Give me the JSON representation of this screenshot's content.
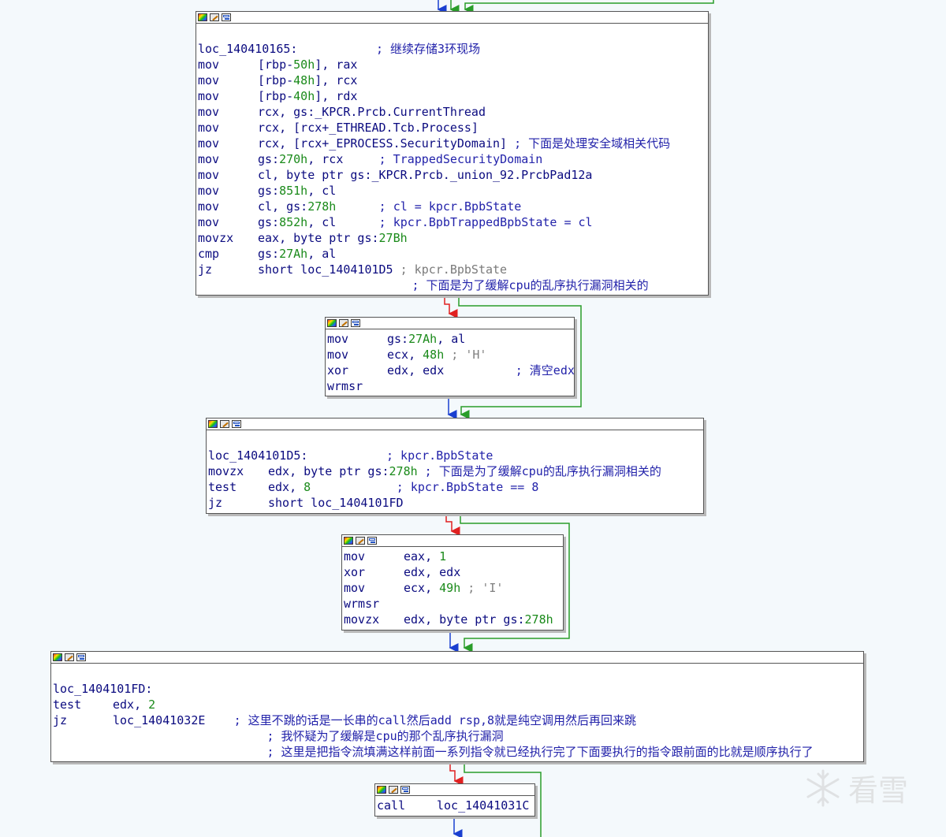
{
  "nodes": [
    {
      "id": "n1",
      "lines": [
        {
          "blank": true
        },
        {
          "label": "loc_140410165:",
          "pad": 11,
          "cmt": "; 继续存储3环现场"
        },
        {
          "m": "mov",
          "ops": [
            [
              "[rbp-",
              "op"
            ],
            [
              "50h",
              "num"
            ],
            [
              "], rax",
              "op"
            ]
          ]
        },
        {
          "m": "mov",
          "ops": [
            [
              "[rbp-",
              "op"
            ],
            [
              "48h",
              "num"
            ],
            [
              "], rcx",
              "op"
            ]
          ]
        },
        {
          "m": "mov",
          "ops": [
            [
              "[rbp-",
              "op"
            ],
            [
              "40h",
              "num"
            ],
            [
              "], rdx",
              "op"
            ]
          ]
        },
        {
          "m": "mov",
          "ops": [
            [
              "rcx, gs:_KPCR.Prcb.CurrentThread",
              "op"
            ]
          ]
        },
        {
          "m": "mov",
          "ops": [
            [
              "rcx, [rcx+_ETHREAD.Tcb.Process]",
              "op"
            ]
          ]
        },
        {
          "m": "mov",
          "ops": [
            [
              "rcx, [rcx+_EPROCESS.SecurityDomain]",
              "op"
            ]
          ],
          "cmt": " ; 下面是处理安全域相关代码"
        },
        {
          "m": "mov",
          "ops": [
            [
              "gs:",
              "op"
            ],
            [
              "270h",
              "num"
            ],
            [
              ", rcx",
              "op"
            ]
          ],
          "pad": 5,
          "cmt": "; TrappedSecurityDomain"
        },
        {
          "m": "mov",
          "ops": [
            [
              "cl, byte ptr gs:_KPCR.Prcb._union_92.PrcbPad12a",
              "op"
            ]
          ]
        },
        {
          "m": "mov",
          "ops": [
            [
              "gs:",
              "op"
            ],
            [
              "851h",
              "num"
            ],
            [
              ", cl",
              "op"
            ]
          ]
        },
        {
          "m": "mov",
          "ops": [
            [
              "cl, gs:",
              "op"
            ],
            [
              "278h",
              "num"
            ]
          ],
          "pad": 6,
          "cmt": "; cl = kpcr.BpbState"
        },
        {
          "m": "mov",
          "ops": [
            [
              "gs:",
              "op"
            ],
            [
              "852h",
              "num"
            ],
            [
              ", cl",
              "op"
            ]
          ],
          "pad": 6,
          "cmt": "; kpcr.BpbTrappedBpbState = cl"
        },
        {
          "m": "movzx",
          "ops": [
            [
              "eax, byte ptr gs:",
              "op"
            ],
            [
              "27Bh",
              "num"
            ]
          ]
        },
        {
          "m": "cmp",
          "ops": [
            [
              "gs:",
              "op"
            ],
            [
              "27Ah",
              "num"
            ],
            [
              ", al",
              "op"
            ]
          ]
        },
        {
          "m": "jz",
          "ops": [
            [
              "short loc_1404101D5",
              "op"
            ]
          ],
          "ref": " ; kpcr.BpbState"
        },
        {
          "indent": 30,
          "cmt": "; 下面是为了缓解cpu的乱序执行漏洞相关的"
        }
      ]
    },
    {
      "id": "n2",
      "lines": [
        {
          "m": "mov",
          "ops": [
            [
              "gs:",
              "op"
            ],
            [
              "27Ah",
              "num"
            ],
            [
              ", al",
              "op"
            ]
          ]
        },
        {
          "m": "mov",
          "ops": [
            [
              "ecx, ",
              "op"
            ],
            [
              "48h",
              "num"
            ]
          ],
          "chr": " ; 'H'"
        },
        {
          "m": "xor",
          "ops": [
            [
              "edx, edx",
              "op"
            ]
          ],
          "pad": 10,
          "cmt": "; 清空edx"
        },
        {
          "m": "wrmsr",
          "ops": []
        }
      ]
    },
    {
      "id": "n3",
      "lines": [
        {
          "blank": true
        },
        {
          "label": "loc_1404101D5:",
          "pad": 11,
          "cmt": "; kpcr.BpbState"
        },
        {
          "m": "movzx",
          "ops": [
            [
              "edx, byte ptr gs:",
              "op"
            ],
            [
              "278h",
              "num"
            ]
          ],
          "cmt": " ; 下面是为了缓解cpu的乱序执行漏洞相关的"
        },
        {
          "m": "test",
          "ops": [
            [
              "edx, ",
              "op"
            ],
            [
              "8",
              "num"
            ]
          ],
          "pad": 12,
          "cmt": "; kpcr.BpbState == 8"
        },
        {
          "m": "jz",
          "ops": [
            [
              "short loc_1404101FD",
              "op"
            ]
          ]
        }
      ]
    },
    {
      "id": "n4",
      "lines": [
        {
          "m": "mov",
          "ops": [
            [
              "eax, ",
              "op"
            ],
            [
              "1",
              "num"
            ]
          ]
        },
        {
          "m": "xor",
          "ops": [
            [
              "edx, edx",
              "op"
            ]
          ]
        },
        {
          "m": "mov",
          "ops": [
            [
              "ecx, ",
              "op"
            ],
            [
              "49h",
              "num"
            ]
          ],
          "chr": " ; 'I'"
        },
        {
          "m": "wrmsr",
          "ops": []
        },
        {
          "m": "movzx",
          "ops": [
            [
              "edx, byte ptr gs:",
              "op"
            ],
            [
              "278h",
              "num"
            ]
          ]
        }
      ]
    },
    {
      "id": "n5",
      "lines": [
        {
          "blank": true
        },
        {
          "label": "loc_1404101FD:"
        },
        {
          "m": "test",
          "ops": [
            [
              "edx, ",
              "op"
            ],
            [
              "2",
              "num"
            ]
          ]
        },
        {
          "m": "jz",
          "ops": [
            [
              "loc_14041032E",
              "op"
            ]
          ],
          "pad": 4,
          "cmt": "; 这里不跳的话是一长串的call然后add rsp,8就是纯空调用然后再回来跳"
        },
        {
          "indent": 30,
          "cmt": "; 我怀疑为了缓解是cpu的那个乱序执行漏洞"
        },
        {
          "indent": 30,
          "cmt": "; 这里是把指令流填满这样前面一系列指令就已经执行完了下面要执行的指令跟前面的比就是顺序执行了"
        }
      ]
    },
    {
      "id": "n6",
      "lines": [
        {
          "m": "call",
          "ops": [
            [
              "loc_14041031C",
              "op"
            ]
          ]
        }
      ]
    }
  ],
  "watermark": {
    "text": "看雪",
    "icon": "snowflake-icon"
  },
  "colors": {
    "branch_true": "#2a9d2a",
    "branch_false": "#e02020",
    "fallthrough": "#1a3fd0",
    "address": "#0b0b80",
    "number": "#1a8a1a",
    "comment": "#2222aa"
  }
}
